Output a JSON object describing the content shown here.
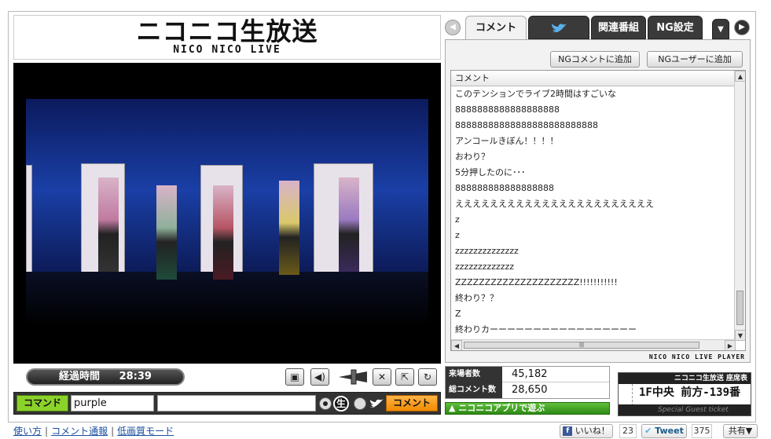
{
  "logo": {
    "title": "ニコニコ生放送",
    "subtitle": "NICO NICO LIVE"
  },
  "player": {
    "elapsed_label": "経過時間",
    "elapsed_time": "28:39",
    "controls": [
      "screen-icon",
      "volume-icon",
      "volume-slider-icon",
      "close-icon",
      "resize-icon",
      "reload-icon"
    ]
  },
  "command_bar": {
    "command_label": "コマンド",
    "command_value": "purple",
    "comment_value": "",
    "send_label": "コメント"
  },
  "tabs": {
    "comment": "コメント",
    "twitter": "twitter-icon",
    "related": "関連番組",
    "ng": "NG設定"
  },
  "ng_buttons": {
    "add_comment": "NGコメントに追加",
    "add_user": "NGユーザーに追加"
  },
  "comments": {
    "header": "コメント",
    "rows": [
      "このテンションでライブ2時間はすごいな",
      "8888888888888888888",
      "88888888888888888888888888",
      "アンコールきぼん！！！！",
      "おわり？",
      "5分押したのに･･･",
      "888888888888888888",
      "えええええええええええええええええええええええ",
      "z",
      "z",
      "zzzzzzzzzzzzzz",
      "zzzzzzzzzzzzz",
      "ZZZZZZZZZZZZZZZZZZZZZ!!!!!!!!!!!",
      "終わり？？",
      "Z",
      "終わりカーーーーーーーーーーーーーーーーー"
    ],
    "player_credit": "NICO NICO LIVE PLAYER"
  },
  "stats": {
    "visitors_label": "来場者数",
    "visitors_value": "45,182",
    "comments_label": "総コメント数",
    "comments_value": "28,650"
  },
  "app_link": "▲ ニコニコアプリで遊ぶ",
  "ticket": {
    "header": "ニコニコ生放送 座席表",
    "seat": "1F中央 前方-139番",
    "footer": "Special Guest ticket"
  },
  "footer": {
    "links": [
      "使い方",
      "コメント通報",
      "低画質モード"
    ],
    "facebook_label": "いいね！",
    "facebook_count": "23",
    "tweet_label": "Tweet",
    "tweet_count": "375",
    "share_label": "共有▼"
  },
  "colors": {
    "command_green": "#8bd22a",
    "send_orange": "#f08a00",
    "tab_dark": "#3a3a3a",
    "link_blue": "#1a4fa0"
  }
}
